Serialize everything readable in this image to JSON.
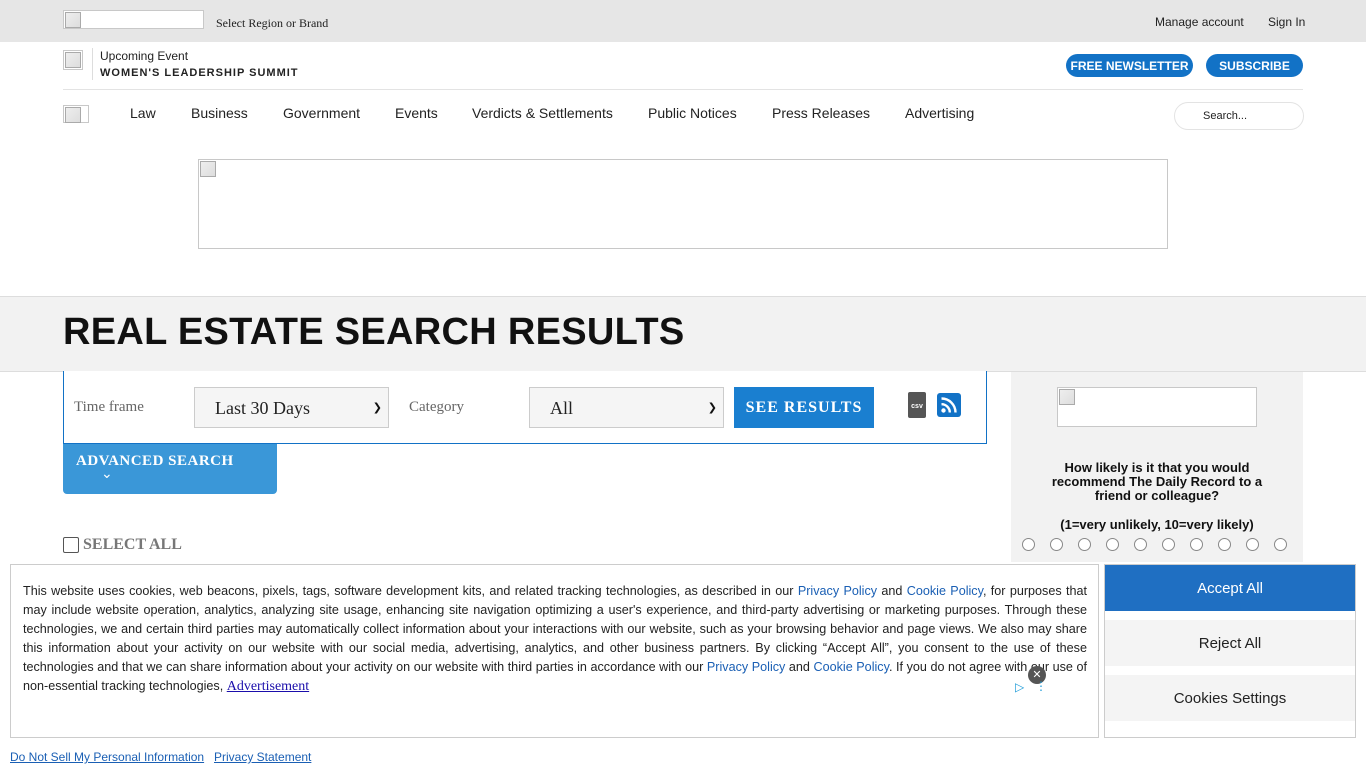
{
  "topbar": {
    "region_label": "Select Region or Brand",
    "manage_account": "Manage account",
    "sign_in": "Sign In"
  },
  "event": {
    "label": "Upcoming Event",
    "name": "WOMEN'S LEADERSHIP SUMMIT"
  },
  "header_buttons": {
    "newsletter": "FREE NEWSLETTER",
    "subscribe": "SUBSCRIBE"
  },
  "nav": {
    "items": [
      "Law",
      "Business",
      "Government",
      "Events",
      "Verdicts & Settlements",
      "Public Notices",
      "Press Releases",
      "Advertising"
    ]
  },
  "search": {
    "placeholder": "Search..."
  },
  "page_title": "REAL ESTATE SEARCH RESULTS",
  "filter": {
    "timeframe_label": "Time frame",
    "timeframe_value": "Last 30 Days",
    "category_label": "Category",
    "category_value": "All",
    "see_results": "SEE RESULTS",
    "csv_icon": "csv",
    "advanced_search": "ADVANCED SEARCH"
  },
  "select_all": "SELECT ALL",
  "survey": {
    "question": "How likely is it that you would recommend The Daily Record to a friend or colleague?",
    "scale": "(1=very unlikely, 10=very likely)",
    "options": 10
  },
  "cookie": {
    "t1": "This website uses cookies, web beacons, pixels, tags, software development kits, and related tracking technologies, as described in our ",
    "privacy_policy": "Privacy Policy",
    "and": " and ",
    "cookie_policy": "Cookie Policy",
    "t2": ", for purposes that may include website operation, analytics, analyzing site usage, enhancing site navigation optimizing a user's experience, and third-party advertising or marketing purposes. Through these technologies, we and certain third parties may automatically collect information about your interactions with our website, such as your browsing behavior and page views. We also may share this information about your activity on our website with our social media, advertising, analytics, and other business partners. By clicking “Accept All”, you consent to the use of these technologies and that we can share information about your activity on our website with third parties in accordance with our ",
    "t3": ". If you do not agree with our use of non-essential tracking technologies, ",
    "advertisement": "Advertisement",
    "accept_all": "Accept All",
    "reject_all": "Reject All",
    "settings": "Cookies Settings"
  },
  "footer": {
    "do_not_sell": "Do Not Sell My Personal Information",
    "privacy_statement": "Privacy Statement"
  },
  "colors": {
    "brand_blue": "#1272c6",
    "accept_blue": "#1f6fc2",
    "advanced_blue": "#3a97d8"
  }
}
